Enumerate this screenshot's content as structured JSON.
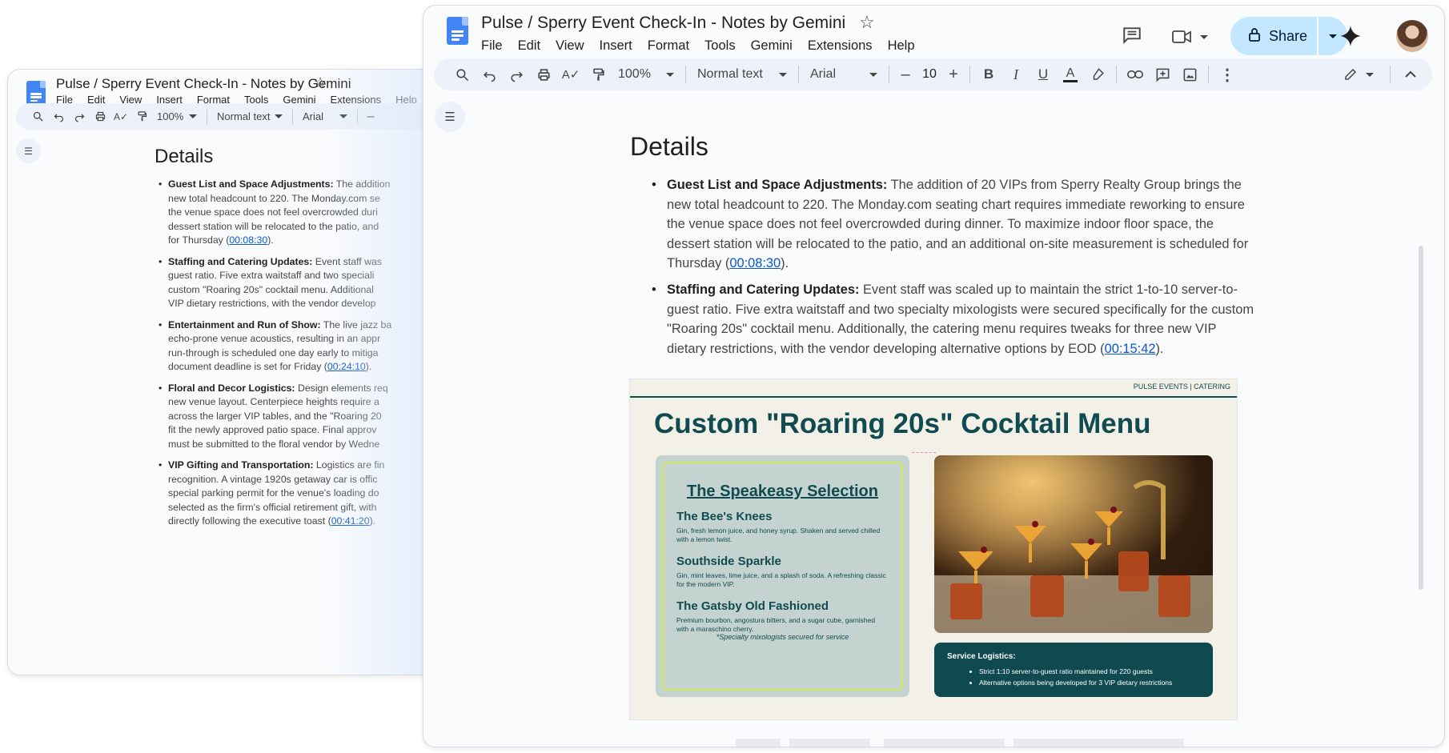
{
  "document": {
    "title": "Pulse / Sperry Event Check-In - Notes by Gemini",
    "menu": [
      "File",
      "Edit",
      "View",
      "Insert",
      "Format",
      "Tools",
      "Gemini",
      "Extensions",
      "Help"
    ]
  },
  "toolbar": {
    "zoom": "100%",
    "style": "Normal text",
    "font": "Arial",
    "font_size": "10"
  },
  "share_label": "Share",
  "content": {
    "heading": "Details",
    "bullets": [
      {
        "label": "Guest List and Space Adjustments:",
        "text": " The addition of 20 VIPs from Sperry Realty Group brings the new total headcount to 220. The Monday.com seating chart requires immediate reworking to ensure the venue space does not feel overcrowded during dinner. To maximize indoor floor space, the dessert station will be relocated to the patio, and an additional on-site measurement is scheduled for Thursday (",
        "link": "00:08:30",
        "end": ")."
      },
      {
        "label": "Staffing and Catering Updates:",
        "text": " Event staff was scaled up to maintain the strict 1-to-10 server-to-guest ratio. Five extra waitstaff and two specialty mixologists were secured specifically for the custom \"Roaring 20s\" cocktail menu. Additionally, the catering menu requires tweaks for three new VIP dietary restrictions, with the vendor developing alternative options by EOD (",
        "link": "00:15:42",
        "end": ")."
      }
    ]
  },
  "back_content": {
    "bullets": [
      {
        "label": "Guest List and Space Adjustments:",
        "text": " The addition",
        "lines": [
          "new total headcount to 220. The Monday.com se",
          "the venue space does not feel overcrowded duri",
          "dessert station will be relocated to the patio, and"
        ],
        "pre": "for Thursday (",
        "link": "00:08:30",
        "end": ")."
      },
      {
        "label": "Staffing and Catering Updates:",
        "text": " Event staff was",
        "lines": [
          "guest ratio. Five extra waitstaff and two speciali",
          "custom \"Roaring 20s\" cocktail menu. Additional"
        ],
        "pre": "VIP dietary restrictions, with the vendor develop",
        "link": "",
        "end": ""
      },
      {
        "label": "Entertainment and Run of Show:",
        "text": " The live jazz ba",
        "lines": [
          "echo-prone venue acoustics, resulting in an appr",
          "run-through is scheduled one day early to mitiga"
        ],
        "pre": "document deadline is set for Friday (",
        "link": "00:24:10",
        "end": ")."
      },
      {
        "label": "Floral and Decor Logistics:",
        "text": " Design elements req",
        "lines": [
          "new venue layout. Centerpiece heights require a",
          "across the larger VIP tables, and the \"Roaring 20",
          "fit the newly approved patio space. Final approv"
        ],
        "pre": "must be submitted to the floral vendor by Wedne",
        "link": "",
        "end": ""
      },
      {
        "label": "VIP Gifting and Transportation:",
        "text": " Logistics are fin",
        "lines": [
          "recognition. A vintage 1920s getaway car is offic",
          "special parking permit for the venue's loading do",
          "selected as the firm's official retirement gift, with"
        ],
        "pre": "directly following the executive toast (",
        "link": "00:41:20",
        "end": ")."
      }
    ]
  },
  "slide": {
    "brand": "PULSE EVENTS | CATERING",
    "title": "Custom \"Roaring 20s\" Cocktail Menu",
    "selection_title": "The Speakeasy Selection",
    "drinks": [
      {
        "name": "The Bee's Knees",
        "desc": "Gin, fresh lemon juice, and honey syrup. Shaken and served chilled with a lemon twist."
      },
      {
        "name": "Southside Sparkle",
        "desc": "Gin, mint leaves, lime juice, and a splash of soda. A refreshing classic for the modern VIP."
      },
      {
        "name": "The Gatsby Old Fashioned",
        "desc": "Premium bourbon, angostura bitters, and a sugar cube, garnished with a maraschino cherry."
      }
    ],
    "note": "*Specialty mixologists secured for service",
    "logistics_title": "Service Logistics:",
    "logistics": [
      "Strict 1:10 server-to-guest ratio maintained for 220 guests",
      "Alternative options being developed for 3 VIP dietary restrictions"
    ]
  },
  "colors": {
    "accent": "#0b57d0",
    "toolbar_bg": "#edf2fa",
    "share_bg": "#c2e7ff",
    "slide_teal": "#0e4a50",
    "slide_lime": "#d4e84f"
  }
}
